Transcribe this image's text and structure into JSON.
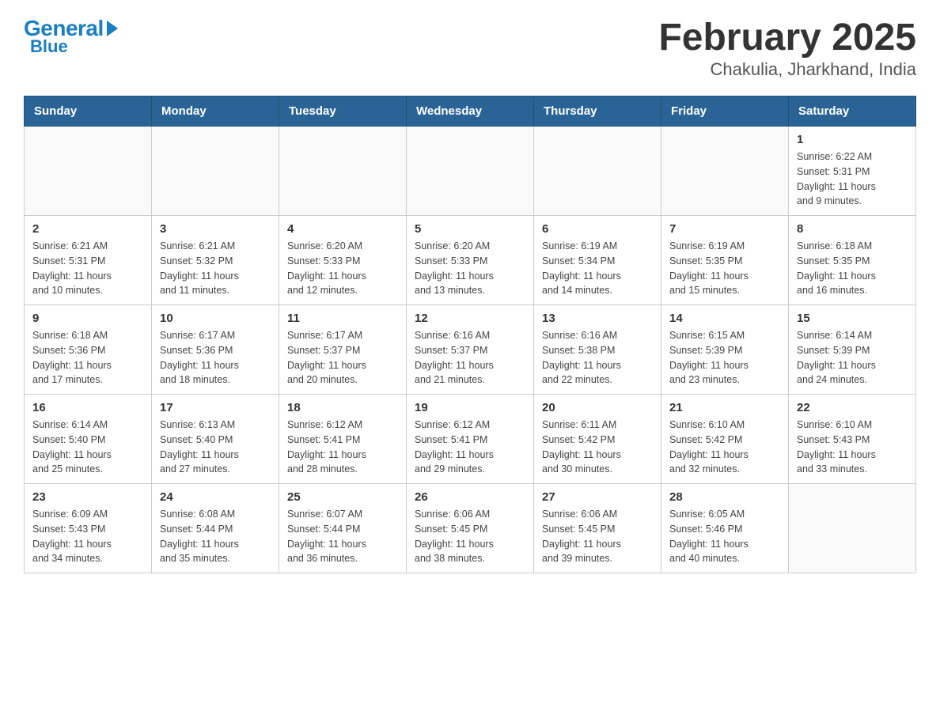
{
  "header": {
    "logo": {
      "general": "General",
      "blue": "Blue"
    },
    "title": "February 2025",
    "subtitle": "Chakulia, Jharkhand, India"
  },
  "weekdays": [
    "Sunday",
    "Monday",
    "Tuesday",
    "Wednesday",
    "Thursday",
    "Friday",
    "Saturday"
  ],
  "weeks": [
    [
      {
        "day": "",
        "info": ""
      },
      {
        "day": "",
        "info": ""
      },
      {
        "day": "",
        "info": ""
      },
      {
        "day": "",
        "info": ""
      },
      {
        "day": "",
        "info": ""
      },
      {
        "day": "",
        "info": ""
      },
      {
        "day": "1",
        "info": "Sunrise: 6:22 AM\nSunset: 5:31 PM\nDaylight: 11 hours\nand 9 minutes."
      }
    ],
    [
      {
        "day": "2",
        "info": "Sunrise: 6:21 AM\nSunset: 5:31 PM\nDaylight: 11 hours\nand 10 minutes."
      },
      {
        "day": "3",
        "info": "Sunrise: 6:21 AM\nSunset: 5:32 PM\nDaylight: 11 hours\nand 11 minutes."
      },
      {
        "day": "4",
        "info": "Sunrise: 6:20 AM\nSunset: 5:33 PM\nDaylight: 11 hours\nand 12 minutes."
      },
      {
        "day": "5",
        "info": "Sunrise: 6:20 AM\nSunset: 5:33 PM\nDaylight: 11 hours\nand 13 minutes."
      },
      {
        "day": "6",
        "info": "Sunrise: 6:19 AM\nSunset: 5:34 PM\nDaylight: 11 hours\nand 14 minutes."
      },
      {
        "day": "7",
        "info": "Sunrise: 6:19 AM\nSunset: 5:35 PM\nDaylight: 11 hours\nand 15 minutes."
      },
      {
        "day": "8",
        "info": "Sunrise: 6:18 AM\nSunset: 5:35 PM\nDaylight: 11 hours\nand 16 minutes."
      }
    ],
    [
      {
        "day": "9",
        "info": "Sunrise: 6:18 AM\nSunset: 5:36 PM\nDaylight: 11 hours\nand 17 minutes."
      },
      {
        "day": "10",
        "info": "Sunrise: 6:17 AM\nSunset: 5:36 PM\nDaylight: 11 hours\nand 18 minutes."
      },
      {
        "day": "11",
        "info": "Sunrise: 6:17 AM\nSunset: 5:37 PM\nDaylight: 11 hours\nand 20 minutes."
      },
      {
        "day": "12",
        "info": "Sunrise: 6:16 AM\nSunset: 5:37 PM\nDaylight: 11 hours\nand 21 minutes."
      },
      {
        "day": "13",
        "info": "Sunrise: 6:16 AM\nSunset: 5:38 PM\nDaylight: 11 hours\nand 22 minutes."
      },
      {
        "day": "14",
        "info": "Sunrise: 6:15 AM\nSunset: 5:39 PM\nDaylight: 11 hours\nand 23 minutes."
      },
      {
        "day": "15",
        "info": "Sunrise: 6:14 AM\nSunset: 5:39 PM\nDaylight: 11 hours\nand 24 minutes."
      }
    ],
    [
      {
        "day": "16",
        "info": "Sunrise: 6:14 AM\nSunset: 5:40 PM\nDaylight: 11 hours\nand 25 minutes."
      },
      {
        "day": "17",
        "info": "Sunrise: 6:13 AM\nSunset: 5:40 PM\nDaylight: 11 hours\nand 27 minutes."
      },
      {
        "day": "18",
        "info": "Sunrise: 6:12 AM\nSunset: 5:41 PM\nDaylight: 11 hours\nand 28 minutes."
      },
      {
        "day": "19",
        "info": "Sunrise: 6:12 AM\nSunset: 5:41 PM\nDaylight: 11 hours\nand 29 minutes."
      },
      {
        "day": "20",
        "info": "Sunrise: 6:11 AM\nSunset: 5:42 PM\nDaylight: 11 hours\nand 30 minutes."
      },
      {
        "day": "21",
        "info": "Sunrise: 6:10 AM\nSunset: 5:42 PM\nDaylight: 11 hours\nand 32 minutes."
      },
      {
        "day": "22",
        "info": "Sunrise: 6:10 AM\nSunset: 5:43 PM\nDaylight: 11 hours\nand 33 minutes."
      }
    ],
    [
      {
        "day": "23",
        "info": "Sunrise: 6:09 AM\nSunset: 5:43 PM\nDaylight: 11 hours\nand 34 minutes."
      },
      {
        "day": "24",
        "info": "Sunrise: 6:08 AM\nSunset: 5:44 PM\nDaylight: 11 hours\nand 35 minutes."
      },
      {
        "day": "25",
        "info": "Sunrise: 6:07 AM\nSunset: 5:44 PM\nDaylight: 11 hours\nand 36 minutes."
      },
      {
        "day": "26",
        "info": "Sunrise: 6:06 AM\nSunset: 5:45 PM\nDaylight: 11 hours\nand 38 minutes."
      },
      {
        "day": "27",
        "info": "Sunrise: 6:06 AM\nSunset: 5:45 PM\nDaylight: 11 hours\nand 39 minutes."
      },
      {
        "day": "28",
        "info": "Sunrise: 6:05 AM\nSunset: 5:46 PM\nDaylight: 11 hours\nand 40 minutes."
      },
      {
        "day": "",
        "info": ""
      }
    ]
  ]
}
